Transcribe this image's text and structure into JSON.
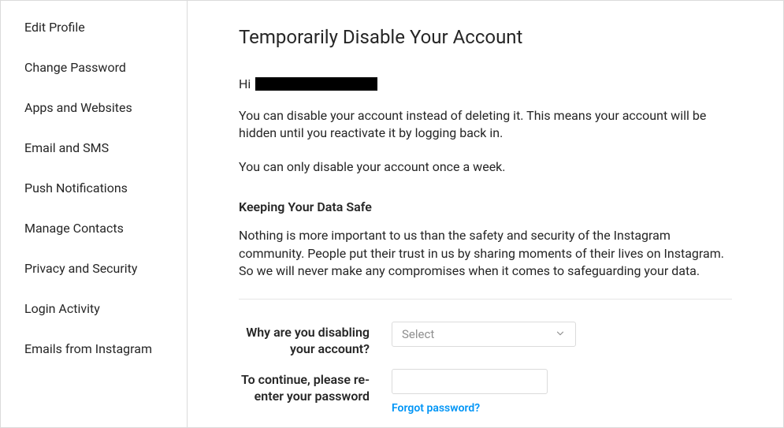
{
  "sidebar": {
    "items": [
      {
        "label": "Edit Profile"
      },
      {
        "label": "Change Password"
      },
      {
        "label": "Apps and Websites"
      },
      {
        "label": "Email and SMS"
      },
      {
        "label": "Push Notifications"
      },
      {
        "label": "Manage Contacts"
      },
      {
        "label": "Privacy and Security"
      },
      {
        "label": "Login Activity"
      },
      {
        "label": "Emails from Instagram"
      }
    ]
  },
  "main": {
    "title": "Temporarily Disable Your Account",
    "greeting_prefix": "Hi",
    "para1": "You can disable your account instead of deleting it. This means your account will be hidden until you reactivate it by logging back in.",
    "para2": "You can only disable your account once a week.",
    "section_heading": "Keeping Your Data Safe",
    "para3": "Nothing is more important to us than the safety and security of the Instagram community. People put their trust in us by sharing moments of their lives on Instagram. So we will never make any compromises when it comes to safeguarding your data.",
    "form": {
      "reason_label": "Why are you disabling your account?",
      "reason_select_value": "Select",
      "password_label": "To continue, please re-enter your password",
      "password_value": "",
      "forgot_link": "Forgot password?"
    }
  }
}
